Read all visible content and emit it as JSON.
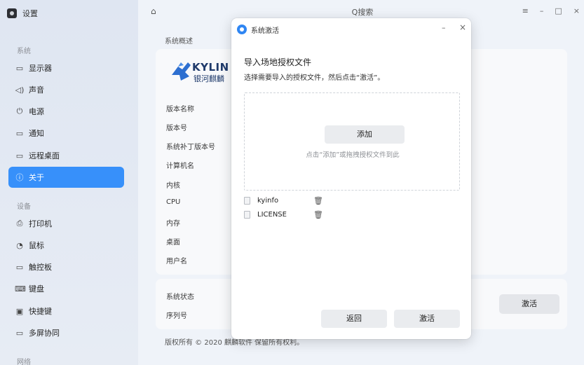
{
  "sidebar": {
    "title": "设置",
    "sections": {
      "system": "系统",
      "devices": "设备",
      "network": "网络"
    },
    "items": [
      {
        "icon": "display-icon",
        "glyph": "▭",
        "label": "显示器"
      },
      {
        "icon": "sound-icon",
        "glyph": "🔈",
        "label": "声音"
      },
      {
        "icon": "power-icon",
        "glyph": "⏻",
        "label": "电源"
      },
      {
        "icon": "notification-icon",
        "glyph": "▭",
        "label": "通知"
      },
      {
        "icon": "remote-desktop-icon",
        "glyph": "▭",
        "label": "远程桌面"
      },
      {
        "icon": "about-icon",
        "glyph": "ⓘ",
        "label": "关于"
      },
      {
        "icon": "printer-icon",
        "glyph": "⎙",
        "label": "打印机"
      },
      {
        "icon": "mouse-icon",
        "glyph": "◔",
        "label": "鼠标"
      },
      {
        "icon": "touchpad-icon",
        "glyph": "▭",
        "label": "触控板"
      },
      {
        "icon": "keyboard-icon",
        "glyph": "⌨",
        "label": "键盘"
      },
      {
        "icon": "shortcut-icon",
        "glyph": "▣",
        "label": "快捷键"
      },
      {
        "icon": "multiscreen-icon",
        "glyph": "▭",
        "label": "多屏协同"
      }
    ],
    "active_item": "关于"
  },
  "header": {
    "search_text": "Q搜索",
    "window_controls": [
      "≡",
      "–",
      "□",
      "×"
    ]
  },
  "main": {
    "section_title": "系统概述",
    "logo": {
      "brand_en": "KYLIN",
      "brand_cn": "银河麒麟"
    },
    "info_labels": [
      "版本名称",
      "版本号",
      "系统补丁版本号",
      "计算机名",
      "内核",
      "CPU",
      "内存",
      "桌面",
      "用户名"
    ],
    "status_labels": [
      "系统状态",
      "序列号"
    ],
    "activate_button": "激活",
    "copyright": "版权所有 © 2020 麒麟软件 保留所有权利。"
  },
  "dialog": {
    "title": "系统激活",
    "minimize": "–",
    "close": "×",
    "heading": "导入场地授权文件",
    "description": "选择需要导入的授权文件，然后点击“激活”。",
    "add_button": "添加",
    "drop_hint": "点击“添加”或拖拽授权文件到此",
    "files": [
      "kyinfo",
      "LICENSE"
    ],
    "back_button": "返回",
    "activate_button": "激活"
  }
}
